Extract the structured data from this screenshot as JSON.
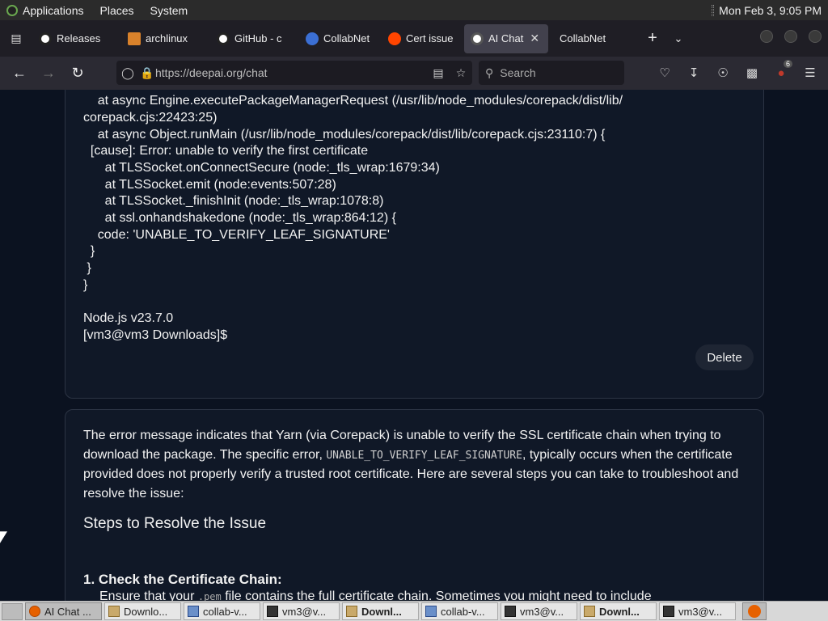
{
  "top_panel": {
    "applications": "Applications",
    "places": "Places",
    "system": "System",
    "clock": "Mon Feb  3,  9:05 PM"
  },
  "tabs": [
    {
      "label": "Releases",
      "icon": "github-icon",
      "active": false
    },
    {
      "label": "archlinux",
      "icon": "archlinux-icon",
      "active": false
    },
    {
      "label": "GitHub - c",
      "icon": "github-icon",
      "active": false
    },
    {
      "label": "CollabNet",
      "icon": "collabnet-icon",
      "active": false
    },
    {
      "label": "Cert issue",
      "icon": "reddit-icon",
      "active": false
    },
    {
      "label": "AI Chat",
      "icon": "deepai-icon",
      "active": true
    },
    {
      "label": "CollabNet",
      "icon": "none",
      "active": false
    }
  ],
  "nav": {
    "url": "https://deepai.org/chat",
    "search_placeholder": "Search",
    "extension_badge": "6"
  },
  "user_message": {
    "lines": [
      "    at async Engine.executePackageManagerRequest (/usr/lib/node_modules/corepack/dist/lib/",
      "corepack.cjs:22423:25)",
      "    at async Object.runMain (/usr/lib/node_modules/corepack/dist/lib/corepack.cjs:23110:7) {",
      "  [cause]: Error: unable to verify the first certificate",
      "      at TLSSocket.onConnectSecure (node:_tls_wrap:1679:34)",
      "      at TLSSocket.emit (node:events:507:28)",
      "      at TLSSocket._finishInit (node:_tls_wrap:1078:8)",
      "      at ssl.onhandshakedone (node:_tls_wrap:864:12) {",
      "    code: 'UNABLE_TO_VERIFY_LEAF_SIGNATURE'",
      "  }",
      " }",
      "}",
      "",
      "Node.js v23.7.0",
      "[vm3@vm3 Downloads]$"
    ],
    "delete_label": "Delete"
  },
  "ai_message": {
    "para_before": "The error message indicates that Yarn (via Corepack) is unable to verify the SSL certificate chain when trying to download the package. The specific error, ",
    "para_code": "UNABLE_TO_VERIFY_LEAF_SIGNATURE",
    "para_after": ", typically occurs when the certificate provided does not properly verify a trusted root certificate. Here are several steps you can take to troubleshoot and resolve the issue:",
    "heading": "Steps to Resolve the Issue",
    "step1_title": "1. Check the Certificate Chain:",
    "step1_before": "Ensure that your ",
    "step1_code": ".pem",
    "step1_after": " file contains the full certificate chain. Sometimes you might need to include"
  },
  "taskbar": {
    "items": [
      {
        "label": "AI Chat ...",
        "icon": "firefox-icon",
        "active": true,
        "bold": false
      },
      {
        "label": "Downlo...",
        "icon": "folder-icon",
        "active": false,
        "bold": false
      },
      {
        "label": "collab-v...",
        "icon": "code-icon",
        "active": false,
        "bold": false
      },
      {
        "label": "vm3@v...",
        "icon": "terminal-icon",
        "active": false,
        "bold": false
      },
      {
        "label": "Downl...",
        "icon": "folder-icon",
        "active": false,
        "bold": true
      },
      {
        "label": "collab-v...",
        "icon": "code-icon",
        "active": false,
        "bold": false
      },
      {
        "label": "vm3@v...",
        "icon": "terminal-icon",
        "active": false,
        "bold": false
      },
      {
        "label": "Downl...",
        "icon": "folder-icon",
        "active": false,
        "bold": true
      },
      {
        "label": "vm3@v...",
        "icon": "terminal-icon",
        "active": false,
        "bold": false
      }
    ]
  },
  "colors": {
    "page_bg": "#0b1220",
    "card_bg": "#101827",
    "tab_active": "#42414d"
  }
}
